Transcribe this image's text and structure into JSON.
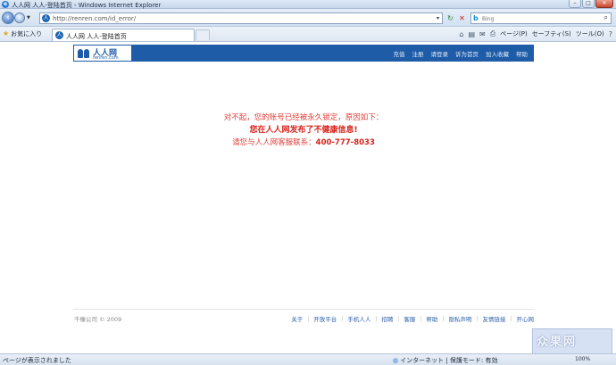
{
  "window": {
    "title": "人人网 人人-登陆首页 - Windows Internet Explorer"
  },
  "address": {
    "url": "http://renren.com/id_error/"
  },
  "search": {
    "placeholder": "Bing"
  },
  "favorites": {
    "label": "お気に入り"
  },
  "tab": {
    "label": "人人网 人人-登陆首页"
  },
  "commandbar": {
    "page": "ページ(P)",
    "safety": "セーフティ(S)",
    "tools": "ツール(O)"
  },
  "site": {
    "logo_cn": "人人网",
    "logo_en": "renren.com",
    "nav": [
      "充值",
      "注册",
      "请登录",
      "诉为首页",
      "加入收藏",
      "帮助"
    ]
  },
  "message": {
    "line1": "对不起，您的账号已经被永久锁定，原因如下：",
    "line2": "您在人人网发布了不健康信息!",
    "line3_prefix": "请您与人人网客服联系：",
    "line3_phone": "400-777-8033"
  },
  "footer": {
    "copyright": "千橡公司 © 2009",
    "links": [
      "关于",
      "开放平台",
      "手机人人",
      "招聘",
      "客服",
      "帮助",
      "隐私声明",
      "友情链接",
      "开心网"
    ]
  },
  "status": {
    "text": "ページが表示されました",
    "zone": "インターネット | 保護モード: 有効",
    "zoom": "100%"
  },
  "watermark": {
    "text": "众果网"
  }
}
